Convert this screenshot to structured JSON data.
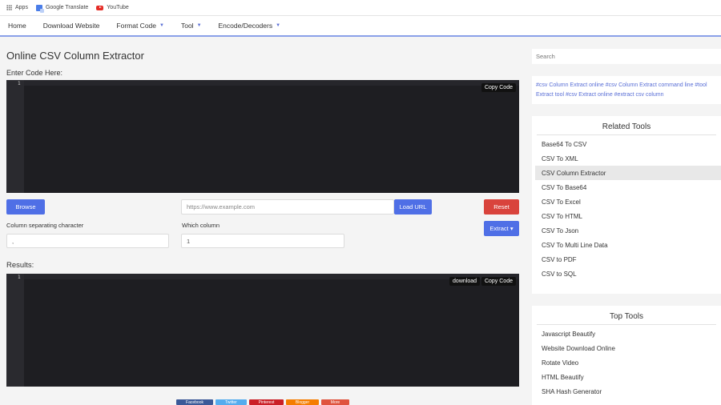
{
  "bookmarks": {
    "items": [
      {
        "label": "Apps",
        "icon": "apps-grid-icon"
      },
      {
        "label": "Google Translate",
        "icon": "google-translate-icon"
      },
      {
        "label": "YouTube",
        "icon": "youtube-icon"
      }
    ]
  },
  "nav": {
    "items": [
      {
        "label": "Home"
      },
      {
        "label": "Download Website"
      },
      {
        "label": "Format Code",
        "caret": "▼"
      },
      {
        "label": "Tool",
        "caret": "▼"
      },
      {
        "label": "Encode/Decoders",
        "caret": "▼"
      }
    ]
  },
  "main": {
    "title": "Online CSV Column Extractor",
    "enter_label": "Enter Code Here:",
    "editor": {
      "line_number": "1",
      "copy_label": "Copy Code"
    },
    "browse_label": "Browse",
    "url_placeholder": "https://www.example.com",
    "load_url_label": "Load URL",
    "reset_label": "Reset",
    "extract_label": "Extract ▾",
    "separator_label": "Column separating character",
    "separator_value": ",",
    "column_label": "Which column",
    "column_value": "1",
    "results_label": "Results:",
    "results": {
      "line_number": "1",
      "download_label": "download",
      "copy_label": "Copy Code"
    },
    "share": [
      {
        "label": "Facebook",
        "color": "#3b5998"
      },
      {
        "label": "Twitter",
        "color": "#55acee"
      },
      {
        "label": "Pinterest",
        "color": "#cb2027"
      },
      {
        "label": "Blogger",
        "color": "#f57d00"
      },
      {
        "label": "More",
        "color": "#e0533e"
      }
    ]
  },
  "sidebar": {
    "search_placeholder": "Search",
    "tags_row1": "#csv Column Extract online  #csv Column Extract command line  #tool",
    "tags_row2": "Extract tool  #csv Extract online  #extract csv column",
    "related": {
      "title": "Related Tools",
      "items": [
        "Base64 To CSV",
        "CSV To XML",
        "CSV Column Extractor",
        "CSV To Base64",
        "CSV To Excel",
        "CSV To HTML",
        "CSV To Json",
        "CSV To Multi Line Data",
        "CSV to PDF",
        "CSV to SQL"
      ],
      "active_index": 2
    },
    "top": {
      "title": "Top Tools",
      "items": [
        "Javascript Beautify",
        "Website Download Online",
        "Rotate Video",
        "HTML Beautify",
        "SHA Hash Generator"
      ]
    }
  }
}
